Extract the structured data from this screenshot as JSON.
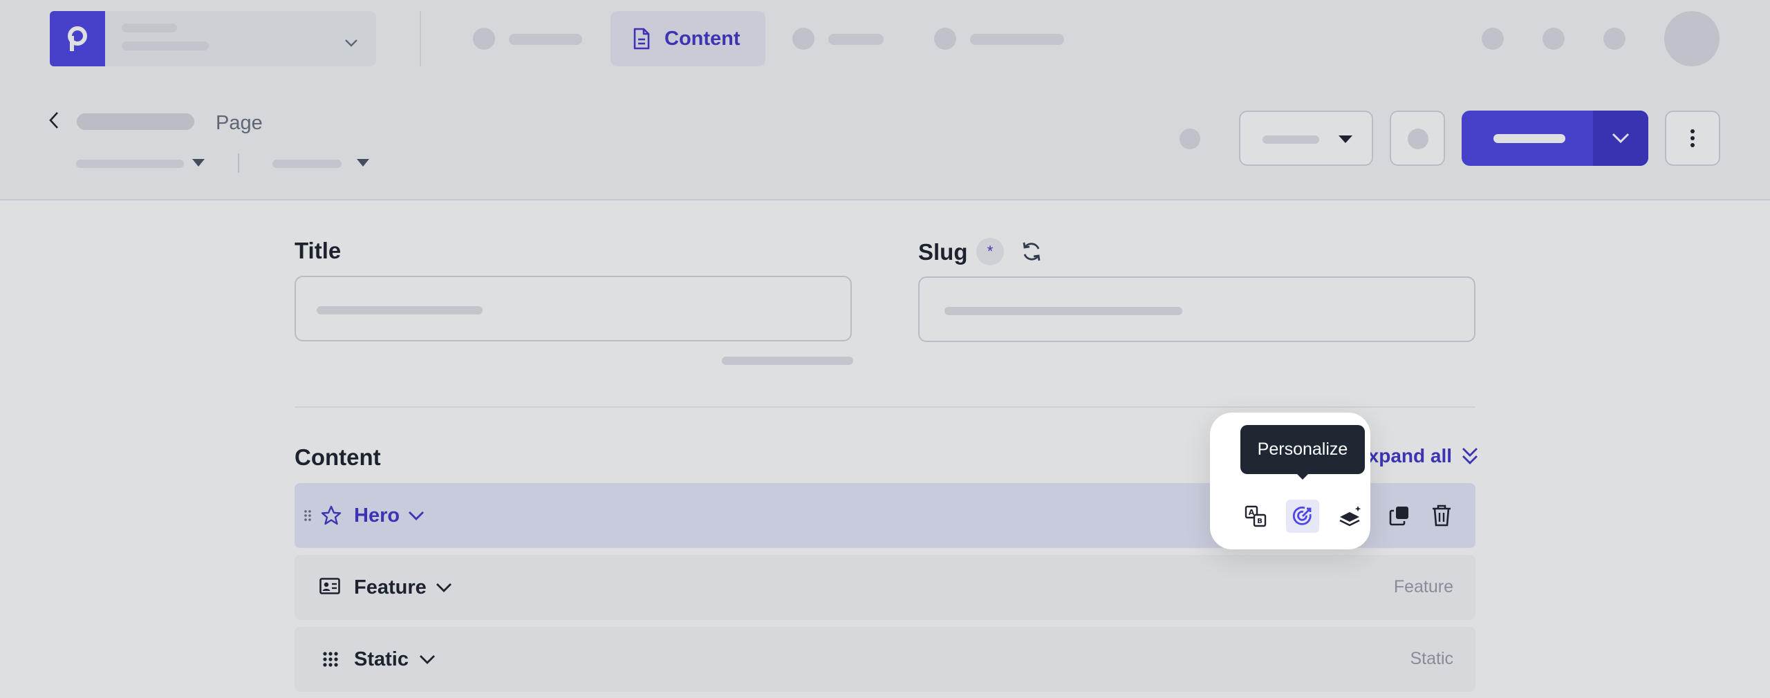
{
  "nav": {
    "active_tab_label": "Content",
    "active_tab_icon": "document-icon"
  },
  "header": {
    "page_type": "Page"
  },
  "form": {
    "title_label": "Title",
    "slug_label": "Slug",
    "slug_required_marker": "*"
  },
  "content": {
    "section_label": "Content",
    "expand_all_label": "Expand all",
    "blocks": [
      {
        "title": "Hero",
        "type_label": "",
        "icon": "star-icon"
      },
      {
        "title": "Feature",
        "type_label": "Feature",
        "icon": "id-card-icon"
      },
      {
        "title": "Static",
        "type_label": "Static",
        "icon": "grid-icon"
      }
    ]
  },
  "tooltip": {
    "text": "Personalize"
  },
  "colors": {
    "accent": "#4f46e5",
    "accent_dark": "#3f37c9",
    "tooltip_bg": "#1f2733"
  }
}
